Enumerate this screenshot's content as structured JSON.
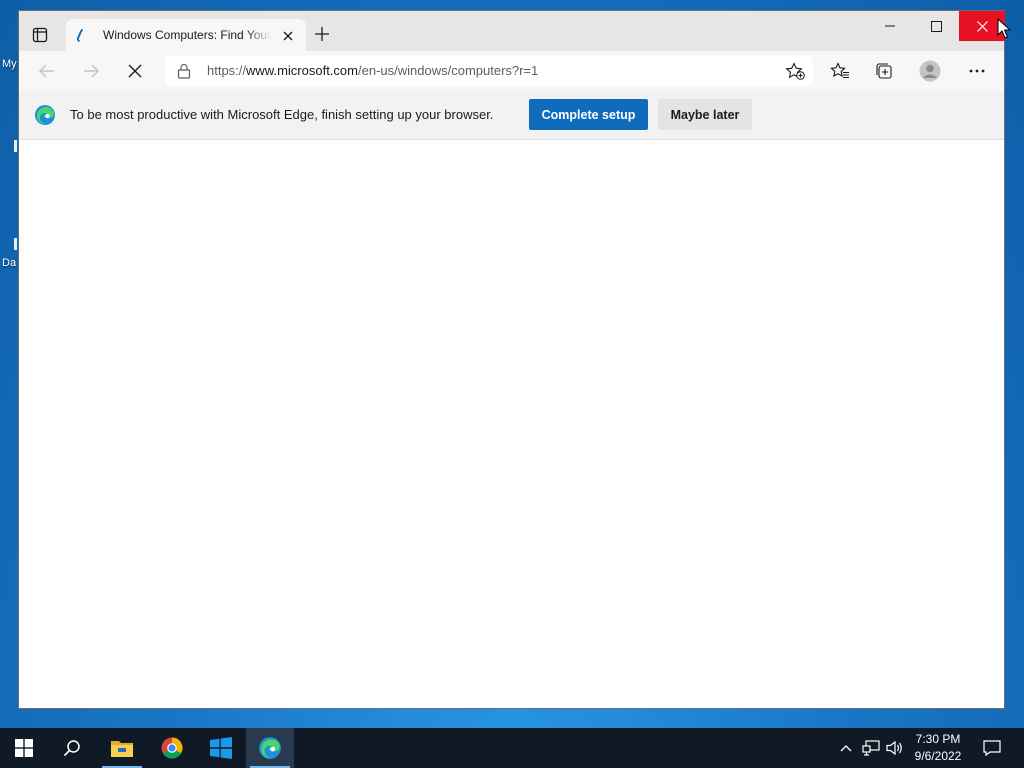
{
  "desktop": {
    "icon_labels": [
      "My",
      "Da"
    ]
  },
  "browser": {
    "tab": {
      "title": "Windows Computers: Find Your Perfect PC | Microsoft"
    },
    "address_bar": {
      "url_prefix": "https://",
      "url_host": "www.microsoft.com",
      "url_path": "/en-us/windows/computers?r=1"
    },
    "infobar": {
      "message": "To be most productive with Microsoft Edge, finish setting up your browser.",
      "primary_button": "Complete setup",
      "secondary_button": "Maybe later"
    },
    "loading": true
  },
  "taskbar": {
    "apps": [
      "start-button",
      "search",
      "file-explorer",
      "chrome",
      "windows-store-app",
      "edge"
    ],
    "active_app": "edge",
    "clock": {
      "time": "7:30 PM",
      "date": "9/6/2022"
    }
  },
  "colors": {
    "accent": "#0f6cbd",
    "close_red": "#e81123",
    "taskbar": "#101a26",
    "desktop": "#1a78c8"
  }
}
